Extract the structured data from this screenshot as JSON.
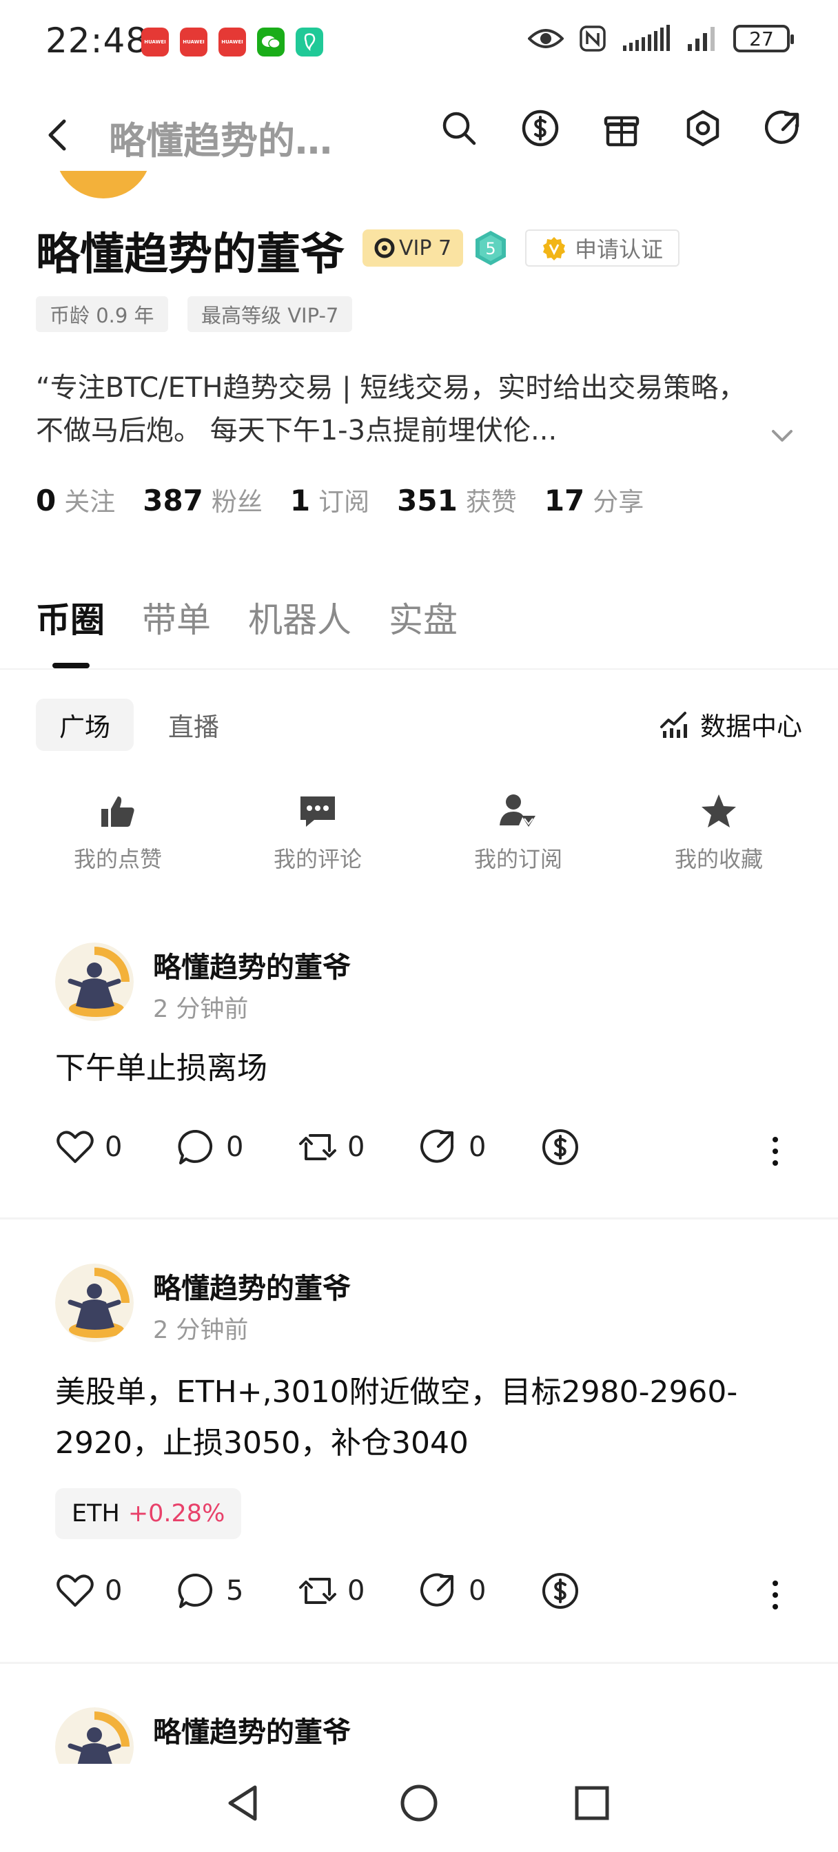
{
  "status_bar": {
    "time": "22:48",
    "app_icons": [
      {
        "label": "HUAWEI",
        "color": "#e53935"
      },
      {
        "label": "HUAWEI",
        "color": "#e53935"
      },
      {
        "label": "HUAWEI",
        "color": "#e53935"
      },
      {
        "label": "",
        "color": "#1aad19"
      },
      {
        "label": "",
        "color": "#20c997"
      }
    ],
    "battery": "27"
  },
  "header": {
    "title": "略懂趋势的…",
    "icons": [
      "search-icon",
      "dollar-icon",
      "gift-icon",
      "settings-icon",
      "share-icon"
    ]
  },
  "profile": {
    "name": "略懂趋势的董爷",
    "vip": "VIP 7",
    "level": "5",
    "verify": "申请认证",
    "chips": [
      "币龄 0.9 年",
      "最高等级 VIP-7"
    ],
    "bio": "“专注BTC/ETH趋势交易 | 短线交易，实时给出交易策略，不做马后炮。 每天下午1-3点提前埋伏伦...",
    "stats": [
      {
        "num": "0",
        "label": "关注"
      },
      {
        "num": "387",
        "label": "粉丝"
      },
      {
        "num": "1",
        "label": "订阅"
      },
      {
        "num": "351",
        "label": "获赞"
      },
      {
        "num": "17",
        "label": "分享"
      }
    ]
  },
  "tabs": [
    "币圈",
    "带单",
    "机器人",
    "实盘"
  ],
  "subtabs": [
    "广场",
    "直播"
  ],
  "data_center": "数据中心",
  "quick_actions": [
    "我的点赞",
    "我的评论",
    "我的订阅",
    "我的收藏"
  ],
  "posts": [
    {
      "author": "略懂趋势的董爷",
      "time": "2 分钟前",
      "body": "下午单止损离场",
      "likes": "0",
      "comments": "0",
      "reposts": "0",
      "shares": "0"
    },
    {
      "author": "略懂趋势的董爷",
      "time": "2 分钟前",
      "body": "美股单，ETH+,3010附近做空，目标2980-2960-2920，止损3050，补仓3040",
      "tag_symbol": "ETH",
      "tag_change": "+0.28%",
      "likes": "0",
      "comments": "5",
      "reposts": "0",
      "shares": "0"
    },
    {
      "author": "略懂趋势的董爷"
    }
  ],
  "colors": {
    "accent_red": "#e8416a",
    "vip_bg": "#fae3a2",
    "level_badge": "#3dbcaa"
  }
}
